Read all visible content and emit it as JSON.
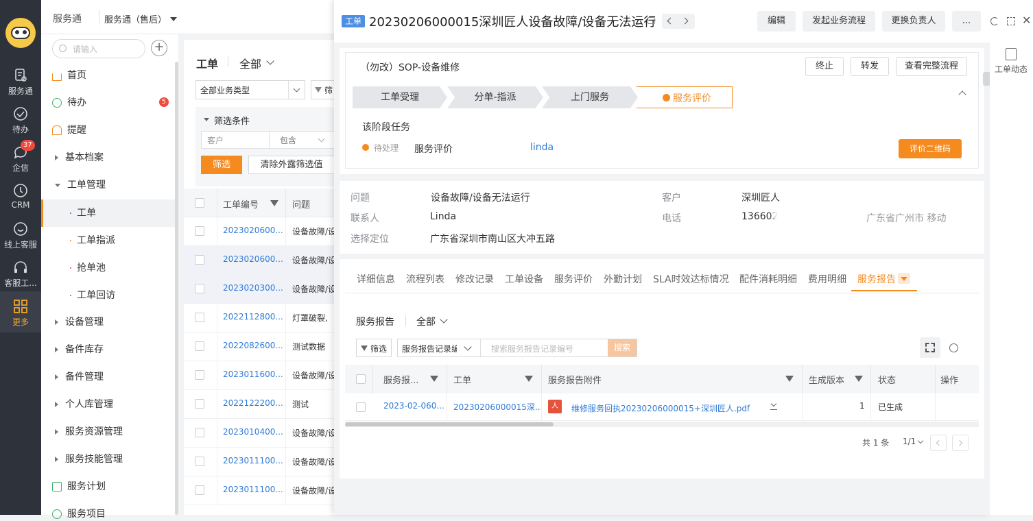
{
  "rail": {
    "items": [
      {
        "label": "服务通",
        "icon": "service-icon"
      },
      {
        "label": "待办",
        "icon": "check-circle-icon"
      },
      {
        "label": "企信",
        "icon": "chat-icon",
        "badge": "37"
      },
      {
        "label": "CRM",
        "icon": "clock-icon"
      },
      {
        "label": "线上客服",
        "icon": "smile-chat-icon"
      },
      {
        "label": "客服工...",
        "icon": "headset-icon"
      },
      {
        "label": "更多",
        "icon": "grid-icon"
      }
    ],
    "active_color": "#f5a623"
  },
  "top": {
    "app": "服务通",
    "scope": "服务通（售后）"
  },
  "menu": {
    "search_placeholder": "请输入",
    "items": [
      {
        "label": "首页"
      },
      {
        "label": "待办",
        "badge": "5"
      },
      {
        "label": "提醒"
      },
      {
        "label": "基本档案"
      },
      {
        "label": "工单管理"
      }
    ],
    "sub": [
      {
        "label": "工单"
      },
      {
        "label": "工单指派"
      },
      {
        "label": "抢单池"
      },
      {
        "label": "工单回访"
      }
    ],
    "more": [
      {
        "label": "设备管理"
      },
      {
        "label": "备件库存"
      },
      {
        "label": "备件管理"
      },
      {
        "label": "个人库管理"
      },
      {
        "label": "服务资源管理"
      },
      {
        "label": "服务技能管理"
      },
      {
        "label": "服务计划"
      },
      {
        "label": "服务项目"
      }
    ]
  },
  "list": {
    "title": "工单",
    "view": "全部",
    "type_filter": "全部业务类型",
    "filter_short": "筛",
    "filter_title": "筛选条件",
    "filter_field": "客户",
    "filter_op": "包含",
    "filter_btn": "筛选",
    "clear_btn": "清除外露筛选值",
    "col_no": "工单编号",
    "col_issue": "问题",
    "rows": [
      {
        "no": "2023020600...",
        "issue": "设备故障/设"
      },
      {
        "no": "2023020600...",
        "issue": "设备故障/设"
      },
      {
        "no": "2023020300...",
        "issue": "设备故障/设"
      },
      {
        "no": "2022112800...",
        "issue": "灯罩破裂,"
      },
      {
        "no": "2022082600...",
        "issue": "测试数据"
      },
      {
        "no": "2023011600...",
        "issue": "设备故障/设"
      },
      {
        "no": "2022122200...",
        "issue": "测试"
      },
      {
        "no": "2023010400...",
        "issue": "设备故障/设"
      },
      {
        "no": "2023011100...",
        "issue": "设备故障/设"
      },
      {
        "no": "2023011100...",
        "issue": "设备故障/设"
      }
    ]
  },
  "detail": {
    "tag": "工单",
    "title": "20230206000015深圳匠人设备故障/设备无法运行",
    "buttons": {
      "edit": "编辑",
      "start_flow": "发起业务流程",
      "change_owner": "更换负责人",
      "more": "..."
    },
    "flow": {
      "name": "（勿改）SOP-设备维修",
      "btn_stop": "终止",
      "btn_forward": "转发",
      "btn_full": "查看完整流程",
      "steps": [
        "工单受理",
        "分单-指派",
        "上门服务",
        "服务评价"
      ],
      "stage_title": "该阶段任务",
      "task_status": "待处理",
      "task_name": "服务评价",
      "task_user": "linda",
      "qr_btn": "评价二维码"
    },
    "info": {
      "issue_label": "问题",
      "issue": "设备故障/设备无法运行",
      "customer_label": "客户",
      "customer": "深圳匠人",
      "contact_label": "联系人",
      "contact": "Linda",
      "phone_label": "电话",
      "phone": "136602",
      "region": "广东省广州市 移动",
      "location_label": "选择定位",
      "location": "广东省深圳市南山区大冲五路"
    },
    "tabs": [
      "详细信息",
      "流程列表",
      "修改记录",
      "工单设备",
      "服务评价",
      "外勤计划",
      "SLA时效达标情况",
      "配件消耗明细",
      "费用明细",
      "服务报告"
    ],
    "report": {
      "title": "服务报告",
      "view": "全部",
      "filter_btn": "筛选",
      "field": "服务报告记录编",
      "search_placeholder": "搜索服务报告记录编号",
      "search_btn": "搜索",
      "cols": {
        "no": "服务报...",
        "order": "工单",
        "attach": "服务报告附件",
        "version": "生成版本",
        "status": "状态",
        "ops": "操作"
      },
      "row": {
        "no": "2023-02-060...",
        "order": "20230206000015深...",
        "attach": "维修服务回执20230206000015+深圳匠人.pdf",
        "version": "1",
        "status": "已生成"
      },
      "total": "共 1 条",
      "page": "1/1"
    },
    "side": {
      "activity": "工单动态"
    }
  },
  "colors": {
    "brand": "#f58a1f",
    "link": "#2f7bd8",
    "tag": "#4e8ee5"
  }
}
